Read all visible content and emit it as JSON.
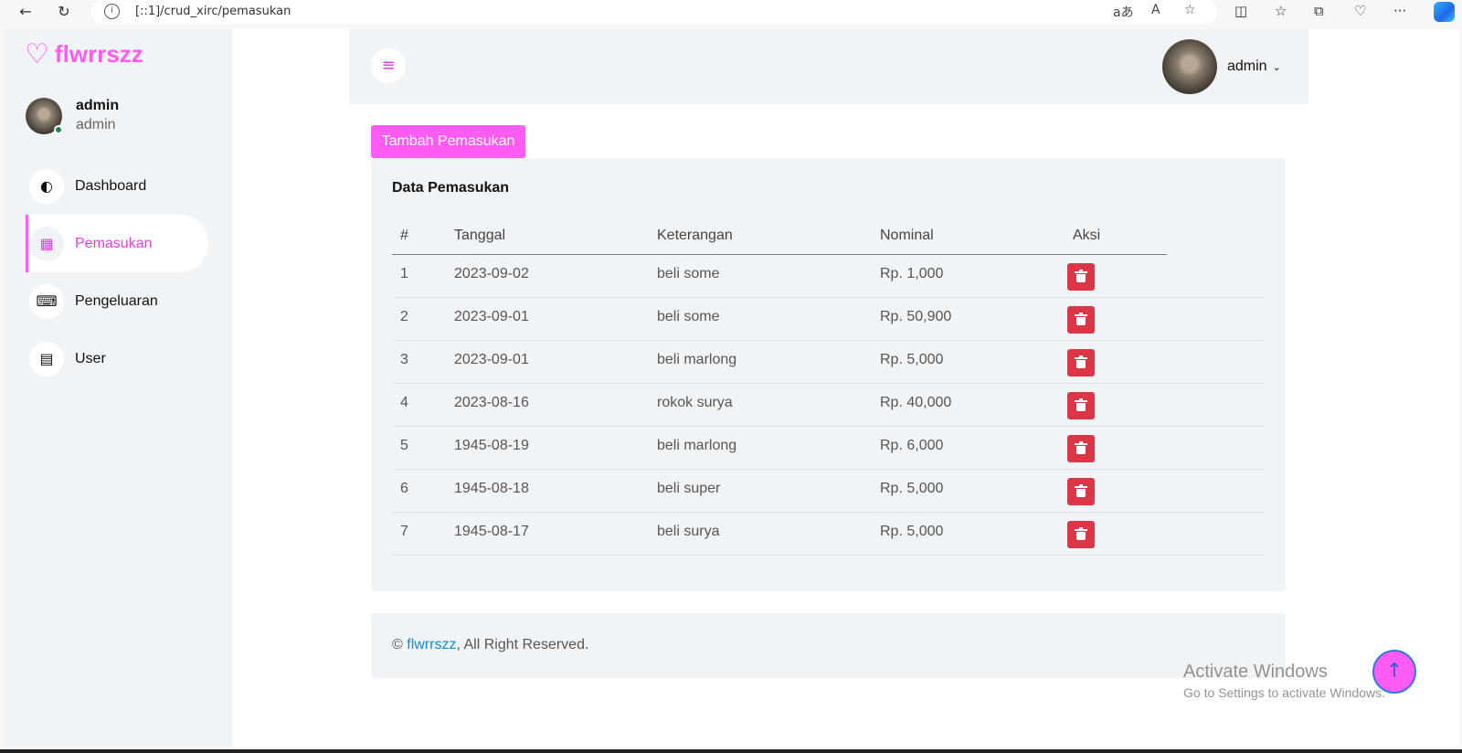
{
  "browser": {
    "url": "[::1]/crud_xirc/pemasukan",
    "back_icon": "←",
    "reload_icon": "↻",
    "info_icon": "i",
    "translate_icon": "aあ",
    "read_aloud_icon": "A",
    "favorite_icon": "☆",
    "split_icon": "◫",
    "favorites_icon": "☆",
    "collections_icon": "⧉",
    "health_icon": "♡",
    "more_icon": "···"
  },
  "brand": {
    "icon": "♡",
    "name": "flwrrszz"
  },
  "profile": {
    "name": "admin",
    "role": "admin"
  },
  "sidebar": {
    "items": [
      {
        "label": "Dashboard",
        "icon": "◐"
      },
      {
        "label": "Pemasukan",
        "icon": "▦"
      },
      {
        "label": "Pengeluaran",
        "icon": "⌨"
      },
      {
        "label": "User",
        "icon": "▤"
      }
    ]
  },
  "topbar": {
    "menu_icon": "≡",
    "user_name": "admin",
    "chevron": "⌄"
  },
  "add_button": "Tambah Pemasukan",
  "card": {
    "title": "Data Pemasukan",
    "columns": [
      "#",
      "Tanggal",
      "Keterangan",
      "Nominal",
      "Aksi"
    ],
    "rows": [
      [
        "1",
        "2023-09-02",
        "beli some",
        "Rp. 1,000"
      ],
      [
        "2",
        "2023-09-01",
        "beli some",
        "Rp. 50,900"
      ],
      [
        "3",
        "2023-09-01",
        "beli marlong",
        "Rp. 5,000"
      ],
      [
        "4",
        "2023-08-16",
        "rokok surya",
        "Rp. 40,000"
      ],
      [
        "5",
        "1945-08-19",
        "beli marlong",
        "Rp. 6,000"
      ],
      [
        "6",
        "1945-08-18",
        "beli super",
        "Rp. 5,000"
      ],
      [
        "7",
        "1945-08-17",
        "beli surya",
        "Rp. 5,000"
      ]
    ]
  },
  "footer": {
    "copyright": "©",
    "brand": "flwrrszz",
    "suffix": ", All Right Reserved."
  },
  "watermark": {
    "line1": "Activate Windows",
    "line2": "Go to Settings to activate Windows."
  },
  "back_to_top_icon": "↑",
  "colors": {
    "accent": "#ff5cf3",
    "danger": "#dc3545",
    "panel": "#f1f4f7",
    "link": "#0d8ad9"
  }
}
